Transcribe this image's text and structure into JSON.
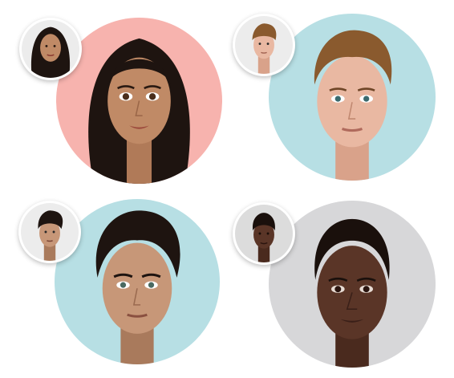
{
  "colors": {
    "bg_pink": "#f7b3ae",
    "bg_teal": "#b7dfe4",
    "bg_grey": "#d7d7d9",
    "skin_tan": "#c08a66",
    "skin_light": "#e9b8a2",
    "skin_olive": "#c79778",
    "skin_dark": "#5a3527",
    "hair_black": "#1e1410",
    "hair_brown": "#8a5a2e"
  },
  "faces": [
    {
      "name": "avatar-woman-long-dark-hair"
    },
    {
      "name": "avatar-man-light-brown-hair"
    },
    {
      "name": "avatar-man-dark-wavy-hair"
    },
    {
      "name": "avatar-woman-braided-hair"
    }
  ]
}
